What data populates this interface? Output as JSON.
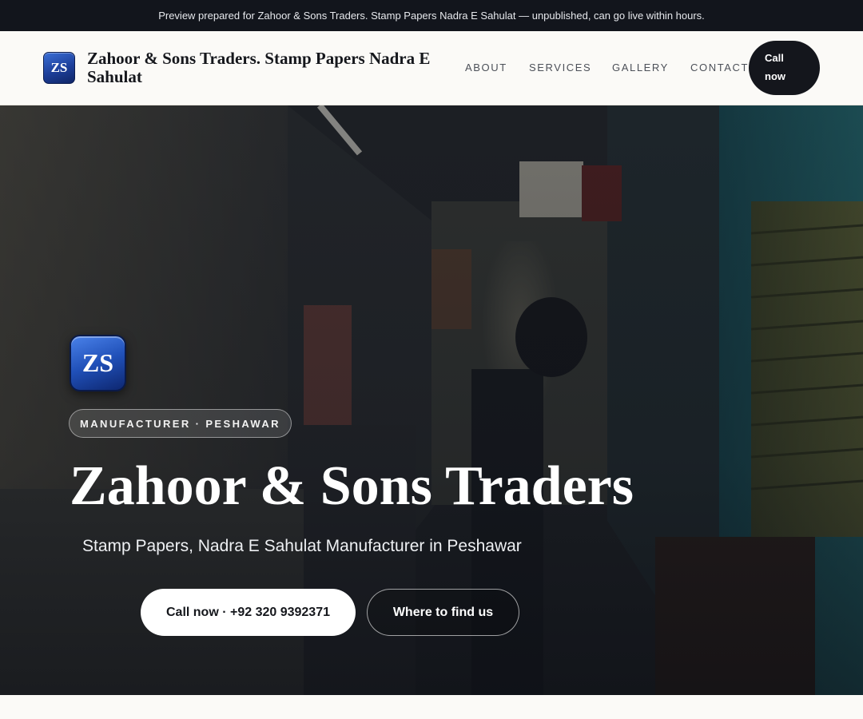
{
  "announcement": "Preview prepared for Zahoor & Sons Traders. Stamp Papers Nadra E Sahulat — unpublished, can go live within hours.",
  "header": {
    "logo_initials": "ZS",
    "brand_name": "Zahoor & Sons Traders. Stamp Papers Nadra E Sahulat",
    "nav": [
      "ABOUT",
      "SERVICES",
      "GALLERY",
      "CONTACT"
    ],
    "call_label_1": "Call",
    "call_label_2": "now"
  },
  "hero": {
    "logo_initials": "ZS",
    "eyebrow": "MANUFACTURER · PESHAWAR",
    "title": "Zahoor & Sons Traders",
    "subtitle": "Stamp Papers, Nadra E Sahulat Manufacturer in Peshawar",
    "primary_cta": "Call now · +92 320 9392371",
    "secondary_cta": "Where to find us"
  },
  "colors": {
    "topbar": "#12151c",
    "accent_dark": "#14161c",
    "logo_blue": "#2050b8",
    "page_bg": "#fbfaf7"
  }
}
